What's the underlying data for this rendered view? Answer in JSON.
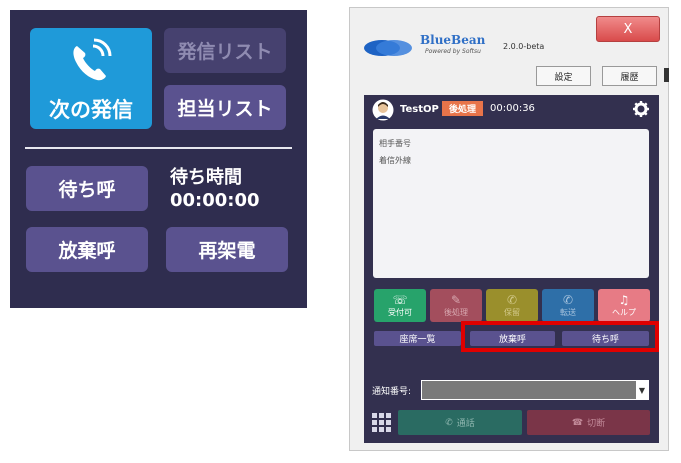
{
  "left_panel": {
    "next_call_label": "次の発信",
    "call_list_label": "発信リスト",
    "assigned_list_label": "担当リスト",
    "waiting_call_label": "待ち呼",
    "wait_time_label": "待ち時間",
    "wait_time_value": "00:00:00",
    "abandoned_call_label": "放棄呼",
    "recall_label": "再架電"
  },
  "window": {
    "close_label": "X",
    "brand_name": "BlueBean",
    "brand_sub": "Powered by Softsu",
    "version": "2.0.0-beta",
    "settings_label": "設定",
    "history_label": "履歴"
  },
  "operator": {
    "name": "TestOP",
    "status_badge": "後処理",
    "timer": "00:00:36",
    "info_lines": [
      "相手番号",
      "着信外線"
    ],
    "buttons": [
      {
        "label": "受付可",
        "icon": "headset-icon",
        "color": "#27a36b"
      },
      {
        "label": "後処理",
        "icon": "memo-icon",
        "color": "#a34e5d"
      },
      {
        "label": "保留",
        "icon": "phone-hold-icon",
        "color": "#9a8f2c"
      },
      {
        "label": "転送",
        "icon": "phone-transfer-icon",
        "color": "#2e6fa8"
      },
      {
        "label": "ヘルプ",
        "icon": "bell-icon",
        "color": "#e77b85"
      }
    ],
    "seat_list_label": "座席一覧",
    "abandoned_label": "放棄呼",
    "waiting_label": "待ち呼",
    "notify_label": "通知番号:",
    "call_label": "通話",
    "hangup_label": "切断"
  },
  "colors": {
    "panel_bg": "#33304f",
    "accent_blue": "#1f9ad9",
    "highlight_red": "#e00000"
  }
}
